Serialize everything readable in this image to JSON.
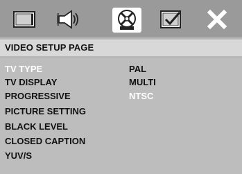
{
  "tabs": [
    {
      "icon": "monitor-icon"
    },
    {
      "icon": "speaker-sound-icon"
    },
    {
      "icon": "video-disc-icon",
      "selected": true
    },
    {
      "icon": "checklist-icon"
    },
    {
      "icon": "close-icon"
    }
  ],
  "page_title": "VIDEO SETUP PAGE",
  "menu": [
    {
      "label": "TV TYPE",
      "highlighted": true
    },
    {
      "label": "TV DISPLAY"
    },
    {
      "label": "PROGRESSIVE"
    },
    {
      "label": "PICTURE SETTING"
    },
    {
      "label": "BLACK LEVEL"
    },
    {
      "label": "CLOSED CAPTION"
    },
    {
      "label": "YUV/S"
    }
  ],
  "options": [
    {
      "label": "PAL"
    },
    {
      "label": "MULTI"
    },
    {
      "label": "NTSC",
      "highlighted": true
    }
  ],
  "colors": {
    "tab_bar": "#9a9a9a",
    "title_bar": "#d8d8d8",
    "body": "#bdbdbd",
    "highlight_text": "#ffffff",
    "text": "#111111"
  }
}
